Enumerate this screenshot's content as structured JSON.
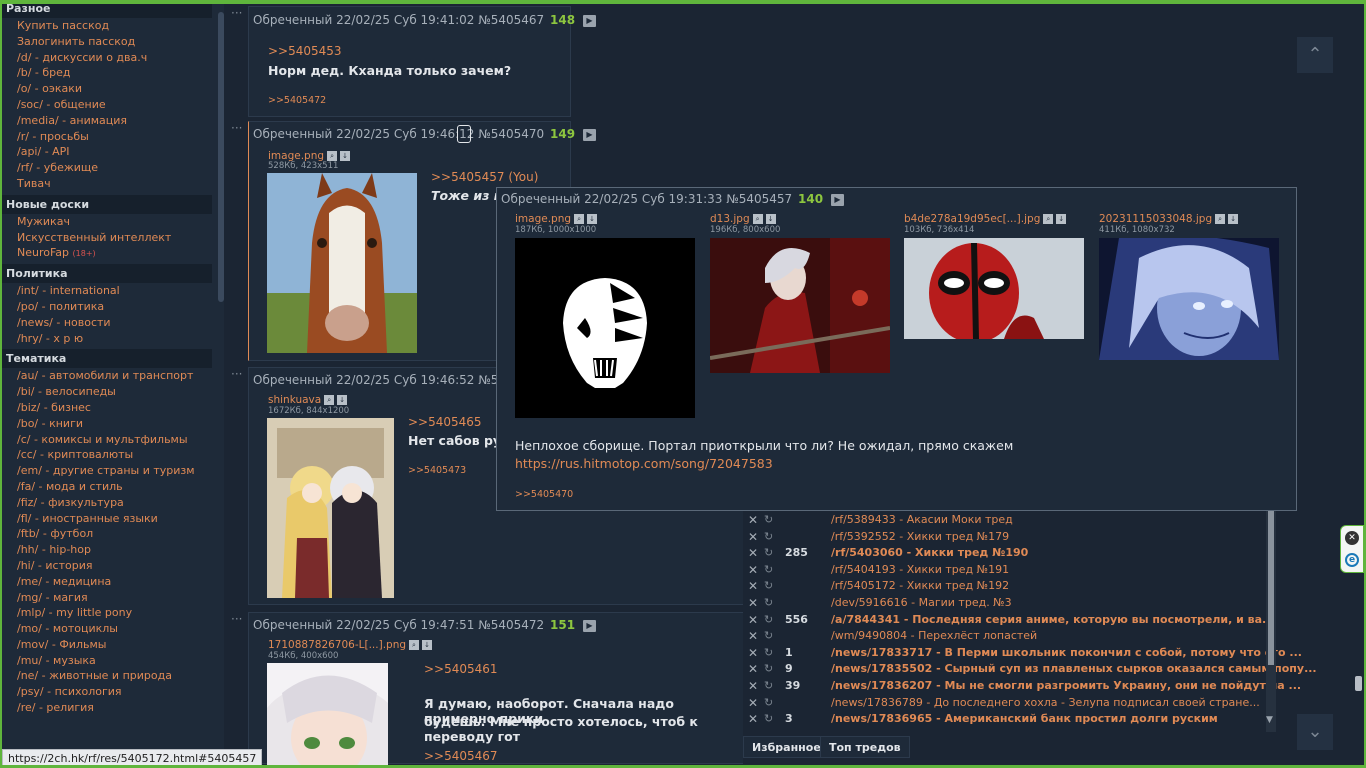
{
  "sidebar": {
    "groups": [
      {
        "title": "Разное",
        "items": [
          {
            "label": "Купить пасскод"
          },
          {
            "label": "Залогинить пасскод"
          },
          {
            "label": "/d/ - дискуссии о два.ч"
          },
          {
            "label": "/b/ - бред"
          },
          {
            "label": "/o/ - оэкаки"
          },
          {
            "label": "/soc/ - общение"
          },
          {
            "label": "/media/ - анимация"
          },
          {
            "label": "/r/ - просьбы"
          },
          {
            "label": "/api/ - API"
          },
          {
            "label": "/rf/ - убежище"
          },
          {
            "label": "Тивач"
          }
        ]
      },
      {
        "title": "Новые доски",
        "items": [
          {
            "label": "Мужикач"
          },
          {
            "label": "Искусственный интеллект"
          },
          {
            "label": "NeuroFap",
            "badge": "(18+)"
          }
        ]
      },
      {
        "title": "Политика",
        "items": [
          {
            "label": "/int/ - international"
          },
          {
            "label": "/po/ - политика"
          },
          {
            "label": "/news/ - новости"
          },
          {
            "label": "/hry/ - х р ю"
          }
        ]
      },
      {
        "title": "Тематика",
        "items": [
          {
            "label": "/au/ - автомобили и транспорт"
          },
          {
            "label": "/bi/ - велосипеды"
          },
          {
            "label": "/biz/ - бизнес"
          },
          {
            "label": "/bo/ - книги"
          },
          {
            "label": "/c/ - комиксы и мультфильмы"
          },
          {
            "label": "/cc/ - криптовалюты"
          },
          {
            "label": "/em/ - другие страны и туризм"
          },
          {
            "label": "/fa/ - мода и стиль"
          },
          {
            "label": "/fiz/ - физкультура"
          },
          {
            "label": "/fl/ - иностранные языки"
          },
          {
            "label": "/ftb/ - футбол"
          },
          {
            "label": "/hh/ - hip-hop"
          },
          {
            "label": "/hi/ - история"
          },
          {
            "label": "/me/ - медицина"
          },
          {
            "label": "/mg/ - магия"
          },
          {
            "label": "/mlp/ - my little pony"
          },
          {
            "label": "/mo/ - мотоциклы"
          },
          {
            "label": "/mov/ - Фильмы"
          },
          {
            "label": "/mu/ - музыка"
          },
          {
            "label": "/ne/ - животные и природа"
          },
          {
            "label": "/psy/ - психология"
          },
          {
            "label": "/re/ - религия"
          }
        ]
      }
    ]
  },
  "posts": [
    {
      "author": "Обреченный",
      "date": "22/02/25 Суб 19:41:02",
      "num": "№5405467",
      "count": "148",
      "reply_to": ">>5405453",
      "text": "Норм дед. Кханда только зачем?",
      "backlink": ">>5405472"
    },
    {
      "author": "Обреченный",
      "date": "22/02/25 Суб 19:46:12",
      "num": "№5405470",
      "count": "149",
      "file": {
        "name": "image.png",
        "meta": "528Кб, 423x511"
      },
      "reply_to": ">>5405457 (You)",
      "text": "Тоже из но"
    },
    {
      "author": "Обреченный",
      "date": "22/02/25 Суб 19:46:52",
      "num": "№5405",
      "file": {
        "name": "shinkuava",
        "meta": "1672Кб, 844x1200"
      },
      "reply_to": ">>5405465",
      "text": "Нет сабов русс",
      "backlink": ">>5405473"
    },
    {
      "author": "Обреченный",
      "date": "22/02/25 Суб 19:47:51",
      "num": "№5405472",
      "count": "151",
      "file": {
        "name": "1710887826706-L[...].png",
        "meta": "454Кб, 400x600"
      },
      "reply_to": ">>5405461",
      "text": "Я думаю, наоборот. Сначала надо примерно прики",
      "text2": "будешь. Мне просто хотелось, чтоб к переводу гот",
      "reply_to2": ">>5405467"
    }
  ],
  "popup": {
    "author": "Обреченный",
    "date": "22/02/25 Суб 19:31:33",
    "num": "№5405457",
    "count": "140",
    "files": [
      {
        "name": "image.png",
        "meta": "187Кб, 1000x1000"
      },
      {
        "name": "d13.jpg",
        "meta": "196Кб, 800x600"
      },
      {
        "name": "b4de278a19d95ec[...].jpg",
        "meta": "103Кб, 736x414"
      },
      {
        "name": "20231115033048.jpg",
        "meta": "411Кб, 1080x732"
      }
    ],
    "text": "Неплохое сборище. Портал приоткрыли что ли? Не ожидал, прямо скажем",
    "link": "https://rus.hitmotop.com/song/72047583",
    "backlink": ">>5405470"
  },
  "threads": [
    {
      "count": "",
      "title": "/rf/5389433 - Акасии Моки тред",
      "bold": false
    },
    {
      "count": "",
      "title": "/rf/5392552 - Хикки тред №179",
      "bold": false
    },
    {
      "count": "285",
      "title": "/rf/5403060 - Хикки тред №190",
      "bold": true
    },
    {
      "count": "",
      "title": "/rf/5404193 - Хикки тред №191",
      "bold": false
    },
    {
      "count": "",
      "title": "/rf/5405172 - Хикки тред №192",
      "bold": false
    },
    {
      "count": "",
      "title": "/dev/5916616 - Магии тред. №3",
      "bold": false
    },
    {
      "count": "556",
      "title": "/a/7844341 - Последняя серия аниме, которую вы посмотрели, и ва...",
      "bold": true
    },
    {
      "count": "",
      "title": "/wm/9490804 - Перехлёст лопастей",
      "bold": false
    },
    {
      "count": "1",
      "title": "/news/17833717 - В Перми школьник покончил с собой, потому что его ...",
      "bold": true
    },
    {
      "count": "9",
      "title": "/news/17835502 - Сырный суп из плавленых сырков оказался самым попу...",
      "bold": true
    },
    {
      "count": "39",
      "title": "/news/17836207 - Мы не смогли разгромить Украину, они не пойдут на ...",
      "bold": true
    },
    {
      "count": "",
      "title": "/news/17836789 - До последнего хохла - Зелупа подписал своей стране...",
      "bold": false
    },
    {
      "count": "3",
      "title": "/news/17836965 - Американский банк простил долги руским",
      "bold": true
    }
  ],
  "tabs": {
    "favorites": "Избранное",
    "top": "Топ тредов"
  },
  "status_url": "https://2ch.hk/rf/res/5405172.html#5405457",
  "icons": {
    "close": "close-icon",
    "refresh": "refresh-icon",
    "scroll_up": "chevron-up-icon",
    "scroll_down": "chevron-down-icon"
  },
  "colors": {
    "accent": "#e08a55",
    "count": "#8dc63f",
    "frame": "#5fb53c",
    "background": "#1b2533"
  }
}
